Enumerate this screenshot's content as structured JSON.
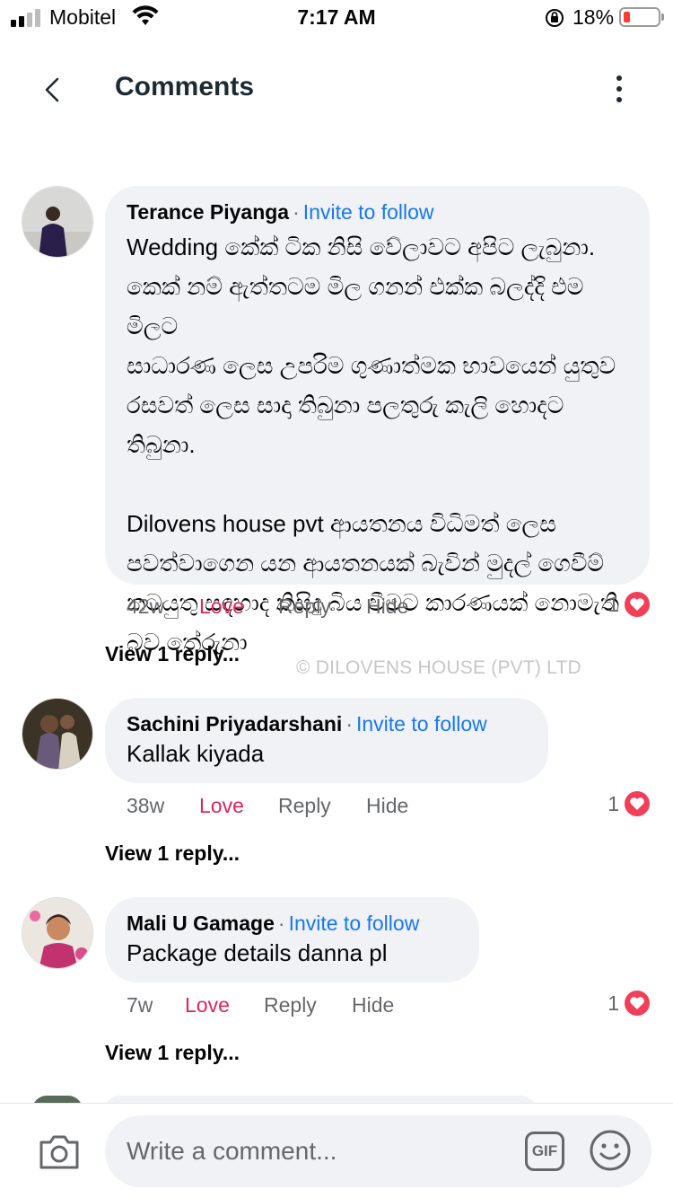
{
  "status_bar": {
    "carrier": "Mobitel",
    "time": "7:17 AM",
    "battery_percent": "18%"
  },
  "header": {
    "title": "Comments"
  },
  "watermark": "© DILOVENS HOUSE (PVT) LTD",
  "comments": [
    {
      "author": "Terance Piyanga",
      "follow_label": "Invite to follow",
      "text": "Wedding කේක් ටික නිසි වේලාවට අපිට ලැබුනා.\nකෙක් නම් ඇත්තටම මිල ගනන් එක්ක බලද්දි එම මිලට\nසාධාරණ ලෙස උපරිම ගුණාත්මක භාවයෙන් යුතුව\nරසවත් ලෙස සාදා තිබුනා පලතුරු කැලි හොදට තිබුනා.\n\nDilovens house pvt ආයතනය විධිමත් ලෙස\nපවත්වාගෙන යන ආයතනයක් බැවින් මුදල් ගෙවීම්\nකටයුතු සඳහාද කිසිදු බිය වීමට කාරණයක් නොමැති\nබව තේරුනා",
      "age": "42w",
      "love_label": "Love",
      "reply_label": "Reply",
      "hide_label": "Hide",
      "reaction_count": "1",
      "view_replies": "View 1 reply..."
    },
    {
      "author": "Sachini Priyadarshani",
      "follow_label": "Invite to follow",
      "text": "Kallak kiyada",
      "age": "38w",
      "love_label": "Love",
      "reply_label": "Reply",
      "hide_label": "Hide",
      "reaction_count": "1",
      "view_replies": "View 1 reply..."
    },
    {
      "author": "Mali U Gamage",
      "follow_label": "Invite to follow",
      "text": "Package details danna pl",
      "age": "7w",
      "love_label": "Love",
      "reply_label": "Reply",
      "hide_label": "Hide",
      "reaction_count": "1",
      "view_replies": "View 1 reply..."
    }
  ],
  "composer": {
    "placeholder": "Write a comment...",
    "gif_label": "GIF"
  },
  "colors": {
    "accent_blue": "#1877f2",
    "love_red": "#e0245e",
    "bubble_gray": "#f0f2f5"
  },
  "icons": {
    "back": "chevron-left-icon",
    "more": "more-vertical-icon",
    "camera": "camera-icon",
    "gif": "gif-icon",
    "emoji": "smiley-icon",
    "reaction": "heart-icon"
  }
}
